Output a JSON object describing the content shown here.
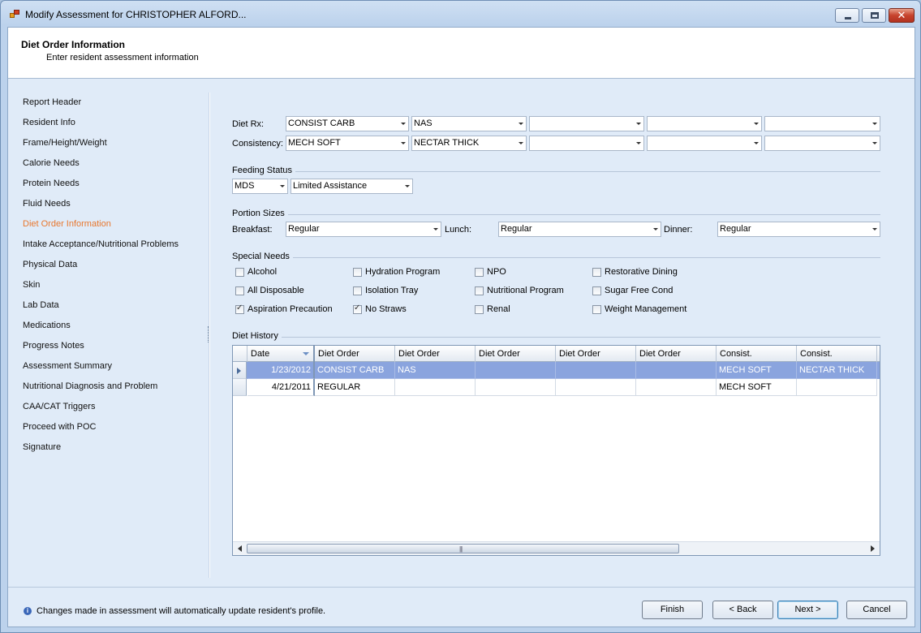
{
  "window": {
    "title": "Modify Assessment for CHRISTOPHER ALFORD...",
    "minimize_icon": "minimize-icon",
    "maximize_icon": "maximize-icon",
    "close_icon": "close-icon",
    "close_glyph": "✕"
  },
  "header": {
    "title": "Diet Order Information",
    "subtitle": "Enter resident assessment information"
  },
  "nav": {
    "items": [
      "Report Header",
      "Resident Info",
      "Frame/Height/Weight",
      "Calorie Needs",
      "Protein Needs",
      "Fluid Needs",
      "Diet Order Information",
      "Intake Acceptance/Nutritional Problems",
      "Physical Data",
      "Skin",
      "Lab Data",
      "Medications",
      "Progress Notes",
      "Assessment Summary",
      "Nutritional Diagnosis and Problem",
      "CAA/CAT Triggers",
      "Proceed with POC",
      "Signature"
    ],
    "active_index": 6,
    "active_color": "#e8772e"
  },
  "diet": {
    "diet_rx_label": "Diet Rx:",
    "consistency_label": "Consistency:",
    "diet_rx_values": [
      "CONSIST CARB",
      "NAS",
      "",
      "",
      ""
    ],
    "consistency_values": [
      "MECH SOFT",
      "NECTAR THICK",
      "",
      "",
      ""
    ]
  },
  "feeding": {
    "section_title": "Feeding Status",
    "source": "MDS",
    "status": "Limited Assistance"
  },
  "portions": {
    "section_title": "Portion Sizes",
    "breakfast_label": "Breakfast:",
    "breakfast": "Regular",
    "lunch_label": "Lunch:",
    "lunch": "Regular",
    "dinner_label": "Dinner:",
    "dinner": "Regular"
  },
  "special_needs": {
    "section_title": "Special Needs",
    "items": [
      {
        "label": "Alcohol",
        "checked": false
      },
      {
        "label": "All Disposable",
        "checked": false
      },
      {
        "label": "Aspiration Precaution",
        "checked": true
      },
      {
        "label": "Hydration Program",
        "checked": false
      },
      {
        "label": "Isolation Tray",
        "checked": false
      },
      {
        "label": "No Straws",
        "checked": true
      },
      {
        "label": "NPO",
        "checked": false
      },
      {
        "label": "Nutritional Program",
        "checked": false
      },
      {
        "label": "Renal",
        "checked": false
      },
      {
        "label": "Restorative Dining",
        "checked": false
      },
      {
        "label": "Sugar Free Cond",
        "checked": false
      },
      {
        "label": "Weight Management",
        "checked": false
      }
    ],
    "check_glyph": "✓"
  },
  "diet_history": {
    "section_title": "Diet History",
    "columns": [
      "Date",
      "Diet Order",
      "Diet Order",
      "Diet Order",
      "Diet Order",
      "Diet Order",
      "Consist.",
      "Consist."
    ],
    "rows": [
      [
        "1/23/2012",
        "CONSIST CARB",
        "NAS",
        "",
        "",
        "",
        "MECH SOFT",
        "NECTAR THICK"
      ],
      [
        "4/21/2011",
        "REGULAR",
        "",
        "",
        "",
        "",
        "MECH SOFT",
        ""
      ]
    ],
    "selected_row": 0,
    "selected_color": "#8aa4de",
    "scroll_grip": "|||"
  },
  "footer": {
    "info_glyph": "i",
    "info_text": "Changes made in assessment will automatically update resident's profile.",
    "buttons": {
      "finish": "Finish",
      "back": "< Back",
      "next": "Next >",
      "cancel": "Cancel"
    }
  }
}
